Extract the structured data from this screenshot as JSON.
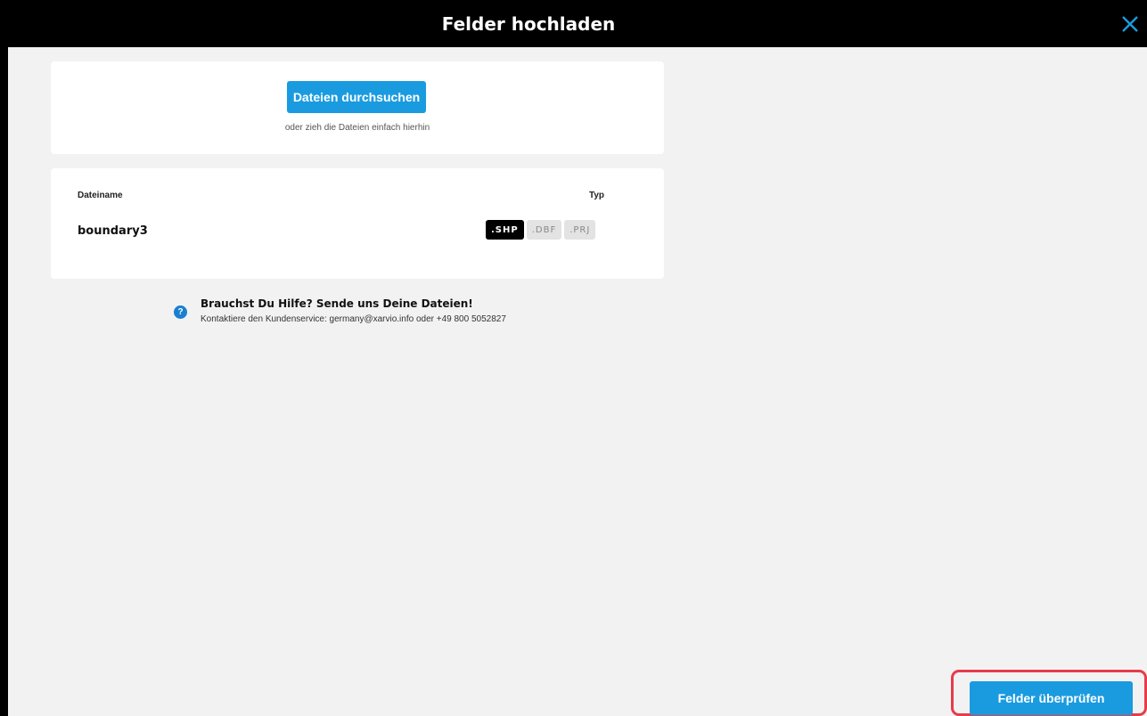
{
  "header": {
    "title": "Felder hochladen",
    "close_icon": "close-icon",
    "accent_color": "#1a9be0"
  },
  "upload": {
    "browse_label": "Dateien durchsuchen",
    "drop_hint": "oder zieh die Dateien einfach hierhin"
  },
  "files": {
    "col_name": "Dateiname",
    "col_type": "Typ",
    "rows": [
      {
        "name": "boundary3",
        "types": [
          ".SHP",
          ".DBF",
          ".PRJ"
        ],
        "active_type": ".SHP"
      }
    ]
  },
  "help": {
    "icon": "question-icon",
    "title": "Brauchst Du Hilfe? Sende uns Deine Dateien!",
    "text": "Kontaktiere den Kundenservice: germany@xarvio.info oder +49 800 5052827"
  },
  "footer": {
    "review_label": "Felder überprüfen",
    "highlight_color": "#e63c4a"
  }
}
